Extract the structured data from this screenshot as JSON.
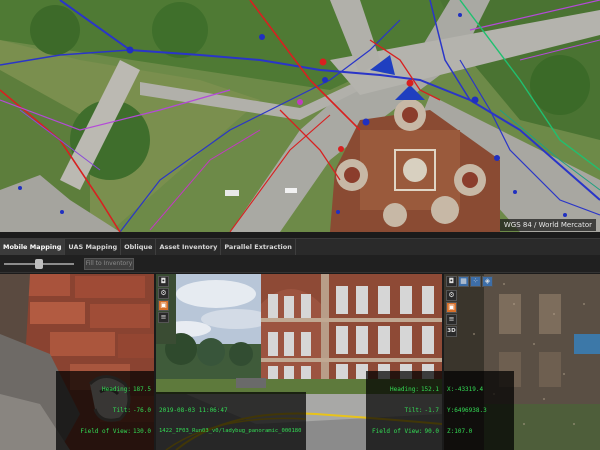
{
  "map": {
    "crs_label": "WGS 84 / World Mercator"
  },
  "tabs": [
    {
      "label": "Mobile Mapping",
      "active": true
    },
    {
      "label": "UAS Mapping",
      "active": false
    },
    {
      "label": "Oblique",
      "active": false
    },
    {
      "label": "Asset Inventory",
      "active": false
    },
    {
      "label": "Parallel Extraction",
      "active": false
    }
  ],
  "toolbar": {
    "slider_value": 0.5,
    "fill_button_label": "Fill to Inventory"
  },
  "panel_a": {
    "heading_label": "Heading:",
    "heading_value": "187.5",
    "tilt_label": "Tilt:",
    "tilt_value": "-76.0",
    "fov_label": "Field of View:",
    "fov_value": "130.0"
  },
  "panel_b": {
    "timestamp": "2019-08-03 11:06:47",
    "filename": "1422_IF03_Run03_v0/ladybug_panoramic_000180"
  },
  "panel_b_right": {
    "heading_label": "Heading:",
    "heading_value": "152.1",
    "tilt_label": "Tilt:",
    "tilt_value": "-1.7",
    "fov_label": "Field of View:",
    "fov_value": "90.0"
  },
  "panel_c": {
    "x_value": "X:-43319.4",
    "y_value": "Y:6496938.3",
    "z_value": "Z:107.0",
    "icon_3d_label": "3D"
  },
  "icons": {
    "panel_b": [
      "camera-icon",
      "gear-icon",
      "image-icon",
      "layers-icon"
    ],
    "panel_c": [
      "camera-icon",
      "image-icon",
      "pointcloud-icon",
      "settings-icon",
      "gear-icon",
      "image-icon",
      "layers-icon",
      "3d-icon"
    ]
  },
  "colors": {
    "overlay_text": "#33dd55",
    "active_tab": "#3b3b3b",
    "orange_icon": "#d8702a"
  }
}
